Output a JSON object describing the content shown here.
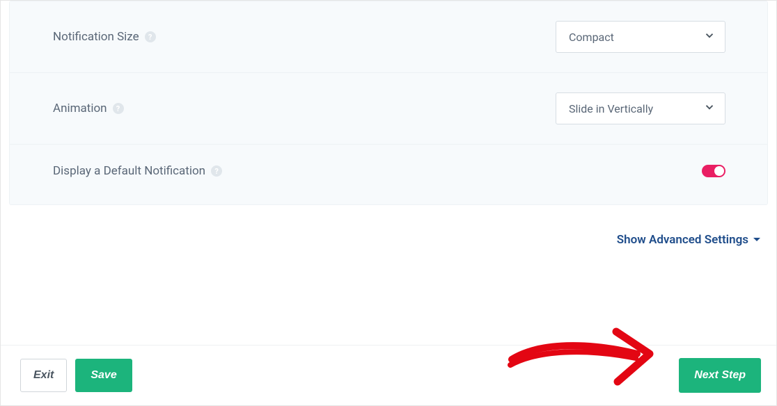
{
  "settings": {
    "notification_size": {
      "label": "Notification Size",
      "value": "Compact"
    },
    "animation": {
      "label": "Animation",
      "value": "Slide in Vertically"
    },
    "default_notification": {
      "label": "Display a Default Notification",
      "enabled": true
    }
  },
  "advanced_link": "Show Advanced Settings",
  "footer": {
    "exit": "Exit",
    "save": "Save",
    "next": "Next Step"
  },
  "colors": {
    "accent_green": "#1cb47c",
    "toggle_pink": "#e91e63",
    "link_blue": "#1e4c8a"
  }
}
